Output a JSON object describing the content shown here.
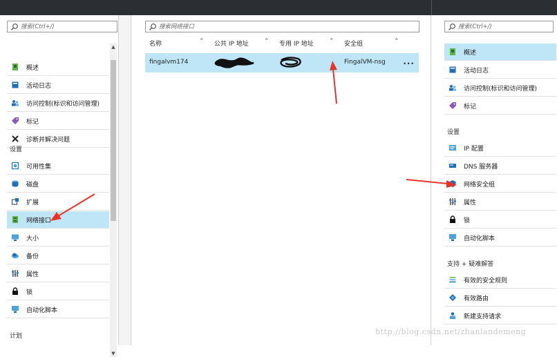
{
  "left": {
    "search_placeholder": "搜索(Ctrl+/)",
    "items_top": [
      {
        "label": "概述",
        "icon": "overview-icon"
      },
      {
        "label": "活动日志",
        "icon": "activity-log-icon"
      },
      {
        "label": "访问控制(标识和访问管理)",
        "icon": "access-control-icon"
      },
      {
        "label": "标记",
        "icon": "tag-icon"
      },
      {
        "label": "诊断并解决问题",
        "icon": "diagnose-icon"
      }
    ],
    "section_settings": "设置",
    "items_settings": [
      {
        "label": "可用性集",
        "icon": "availability-set-icon"
      },
      {
        "label": "磁盘",
        "icon": "disk-icon"
      },
      {
        "label": "扩展",
        "icon": "extension-icon"
      },
      {
        "label": "网络接口",
        "icon": "network-interface-icon",
        "selected": true
      },
      {
        "label": "大小",
        "icon": "size-icon"
      },
      {
        "label": "备份",
        "icon": "backup-icon"
      },
      {
        "label": "属性",
        "icon": "properties-icon"
      },
      {
        "label": "锁",
        "icon": "lock-icon"
      },
      {
        "label": "自动化脚本",
        "icon": "automation-script-icon"
      }
    ],
    "section_plan": "计划"
  },
  "middle": {
    "search_placeholder": "搜索网络接口",
    "columns": [
      "名称",
      "公共 IP 地址",
      "专用 IP 地址",
      "安全组"
    ],
    "rows": [
      {
        "name": "fingalvm174",
        "public_ip": "",
        "private_ip": "",
        "security_group": "FingalVM-nsg",
        "more": "..."
      }
    ]
  },
  "right": {
    "search_placeholder": "搜索(Ctrl+/)",
    "items_top": [
      {
        "label": "概述",
        "icon": "overview-icon",
        "selected": true
      },
      {
        "label": "活动日志",
        "icon": "activity-log-icon"
      },
      {
        "label": "访问控制(标识和访问管理)",
        "icon": "access-control-icon"
      },
      {
        "label": "标记",
        "icon": "tag-icon"
      }
    ],
    "section_settings": "设置",
    "items_settings": [
      {
        "label": "IP 配置",
        "icon": "ip-config-icon"
      },
      {
        "label": "DNS 服务器",
        "icon": "dns-server-icon"
      },
      {
        "label": "网络安全组",
        "icon": "network-security-group-icon"
      },
      {
        "label": "属性",
        "icon": "properties-icon"
      },
      {
        "label": "锁",
        "icon": "lock-icon"
      },
      {
        "label": "自动化脚本",
        "icon": "automation-script-icon"
      }
    ],
    "section_support": "支持 + 疑难解答",
    "items_support": [
      {
        "label": "有效的安全规则",
        "icon": "security-rules-icon"
      },
      {
        "label": "有效路由",
        "icon": "routes-icon"
      },
      {
        "label": "新建支持请求",
        "icon": "support-request-icon"
      }
    ]
  },
  "watermark": "http://blog.csdn.net/zhanlandemeng",
  "colors": {
    "selected": "#bfe6f6",
    "topbar": "#2b2e33",
    "arrow": "#e8332a",
    "accent": "#0072c6"
  }
}
